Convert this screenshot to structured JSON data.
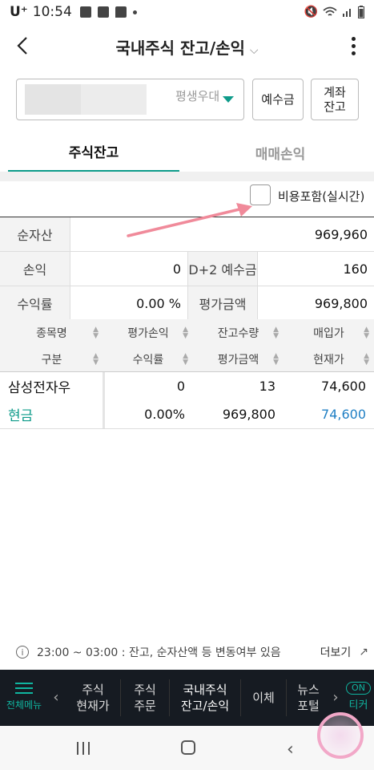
{
  "status": {
    "carrier": "U⁺",
    "time": "10:54"
  },
  "header": {
    "title": "국내주식 잔고/손익",
    "chevron": "⌵"
  },
  "account": {
    "name": "평생우대",
    "deposit_button": "예수금",
    "balance_button_line1": "계좌",
    "balance_button_line2": "잔고"
  },
  "tabs": [
    {
      "label": "주식잔고",
      "active": true
    },
    {
      "label": "매매손익",
      "active": false
    }
  ],
  "cost_option": {
    "label": "비용포함(실시간)",
    "checked": false
  },
  "summary": {
    "net_assets_label": "순자산",
    "net_assets": "969,960",
    "pnl_label": "손익",
    "pnl": "0",
    "deposit_label": "D+2 예수금",
    "deposit": "160",
    "return_label": "수익률",
    "return": "0.00 %",
    "eval_label": "평가금액",
    "eval": "969,800"
  },
  "holdings": {
    "headers_row1": [
      "종목명",
      "평가손익",
      "잔고수량",
      "매입가"
    ],
    "headers_row2": [
      "구분",
      "수익률",
      "평가금액",
      "현재가"
    ],
    "rows": [
      {
        "name": "삼성전자우",
        "pnl": "0",
        "qty": "13",
        "buy_price": "74,600",
        "type": "현금",
        "rate": "0.00%",
        "eval": "969,800",
        "cur_price": "74,600"
      }
    ]
  },
  "info": {
    "text": "23:00 ~ 03:00 : 잔고, 순자산액 등 변동여부 있음",
    "more": "더보기",
    "ext_icon": "↗"
  },
  "bottom_nav": {
    "menu": "전체메뉴",
    "items": [
      {
        "line1": "주식",
        "line2": "현재가"
      },
      {
        "line1": "주식",
        "line2": "주문"
      },
      {
        "line1": "국내주식",
        "line2": "잔고/손익"
      },
      {
        "line1": "이체",
        "line2": ""
      },
      {
        "line1": "뉴스",
        "line2": "포털"
      }
    ],
    "ticker_badge": "ON",
    "ticker_label": "티커"
  },
  "colors": {
    "accent": "#0e9b8a",
    "blue_value": "#1f7fc4",
    "cash_label": "#0e9b8a",
    "arrow": "#f08a9a"
  }
}
